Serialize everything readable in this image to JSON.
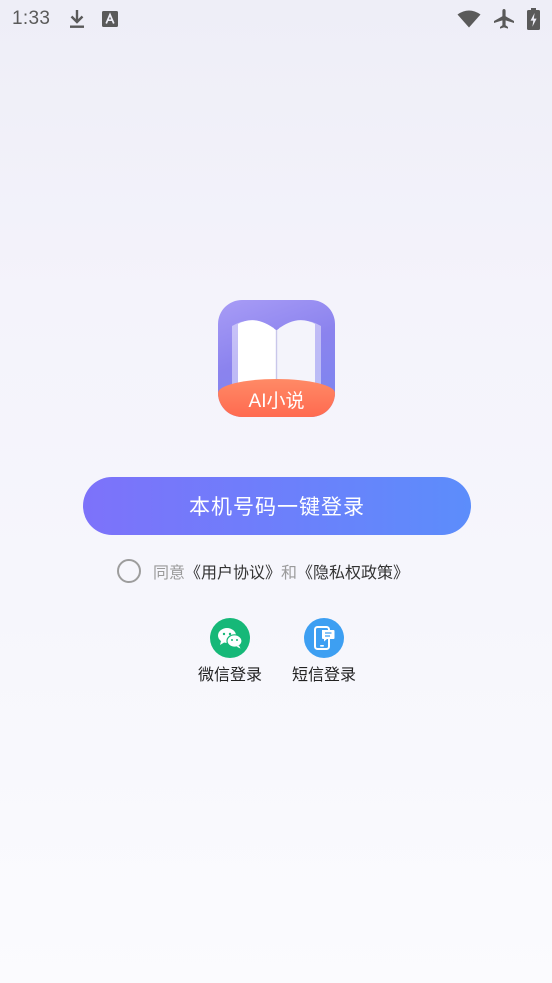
{
  "status_bar": {
    "time": "1:33",
    "left_icons": [
      "download-icon",
      "translate-icon"
    ],
    "right_icons": [
      "wifi-icon",
      "airplane-mode-icon",
      "battery-charging-icon"
    ]
  },
  "app": {
    "logo_icon": "open-book-icon",
    "logo_text": "AI小说"
  },
  "login": {
    "one_click_label": "本机号码一键登录",
    "agreement": {
      "prefix": "同意",
      "user_agreement": "《用户协议》",
      "conjunction": "和",
      "privacy_policy": "《隐私权政策》"
    },
    "options": [
      {
        "label": "微信登录",
        "icon": "wechat-icon",
        "color": "#16b878"
      },
      {
        "label": "短信登录",
        "icon": "sms-phone-icon",
        "color": "#3d9ff2"
      }
    ]
  },
  "colors": {
    "button_gradient_start": "#7d72fa",
    "button_gradient_end": "#5c8dfb",
    "logo_banner": "#ff6a50"
  }
}
